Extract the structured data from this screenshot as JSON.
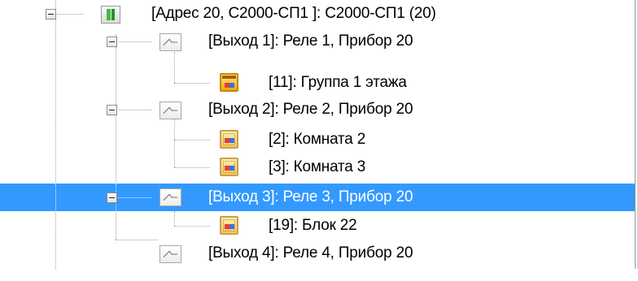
{
  "tree": {
    "device": {
      "label": "[Адрес 20, С2000-СП1 ]: С2000-СП1 (20)",
      "icon": "device-module-icon"
    },
    "outputs": [
      {
        "label": "[Выход 1]: Реле 1, Прибор 20",
        "icon": "relay-icon",
        "children": [
          {
            "label": "[11]: Группа 1 этажа",
            "icon": "group-icon"
          }
        ]
      },
      {
        "label": "[Выход 2]: Реле 2, Прибор 20",
        "icon": "relay-icon",
        "children": [
          {
            "label": "[2]: Комната 2",
            "icon": "room-icon"
          },
          {
            "label": "[3]: Комната 3",
            "icon": "room-icon"
          }
        ]
      },
      {
        "label": "[Выход 3]: Реле 3, Прибор 20",
        "icon": "relay-icon",
        "selected": true,
        "children": [
          {
            "label": "[19]: Блок 22",
            "icon": "room-icon"
          }
        ]
      },
      {
        "label": "[Выход 4]: Реле 4, Прибор 20",
        "icon": "relay-icon"
      }
    ]
  },
  "colors": {
    "selection": "#3399ff",
    "tree_lines": "#a0a0a0",
    "background": "#ffffff"
  }
}
